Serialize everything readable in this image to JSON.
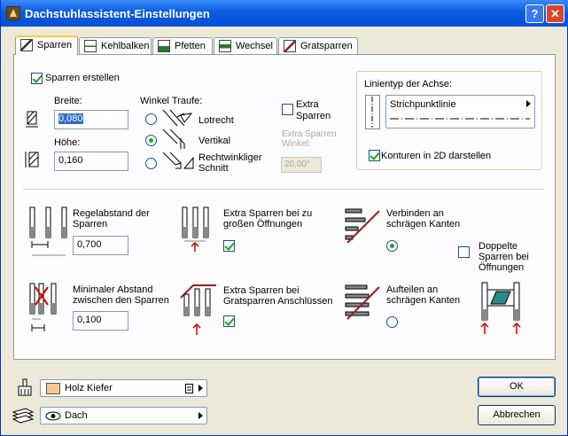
{
  "window": {
    "title": "Dachstuhlassistent-Einstellungen",
    "help_label": "?",
    "close_label": "✕"
  },
  "tabs": [
    {
      "label": "Sparren",
      "active": true
    },
    {
      "label": "Kehlbalken"
    },
    {
      "label": "Pfetten"
    },
    {
      "label": "Wechsel"
    },
    {
      "label": "Gratsparren"
    }
  ],
  "sparren": {
    "create_label": "Sparren erstellen",
    "create_checked": true,
    "breite_label": "Breite:",
    "breite_value": "0,080",
    "hoehe_label": "Höhe:",
    "hoehe_value": "0,160",
    "winkel_label": "Winkel Traufe:",
    "winkel_options": [
      "Lotrecht",
      "Vertikal",
      "Rechtwinkliger Schnitt"
    ],
    "winkel_selected": "Vertikal",
    "extra_label": "Extra Sparren",
    "extra_checked": false,
    "extra_winkel_label": "Extra Sparren Winkel:",
    "extra_winkel_value": "20,00°"
  },
  "linientyp": {
    "title": "Linientyp der Achse:",
    "value": "Strichpunktlinie",
    "konturen_label": "Konturen in 2D darstellen",
    "konturen_checked": true
  },
  "options": {
    "regelabstand_label": "Regelabstand der Sparren",
    "regelabstand_value": "0,700",
    "extra_oeffnungen_label": "Extra Sparren bei zu großen Öffnungen",
    "extra_oeffnungen_checked": true,
    "verbinden_label": "Verbinden an schrägen Kanten",
    "verbinden_selected": true,
    "doppelte_label": "Doppelte Sparren bei Öffnungen",
    "doppelte_checked": false,
    "min_abstand_label": "Minimaler Abstand zwischen den Sparren",
    "min_abstand_value": "0,100",
    "extra_grat_label": "Extra Sparren bei Gratsparren Anschlüssen",
    "extra_grat_checked": true,
    "aufteilen_label": "Aufteilen an schrägen Kanten",
    "aufteilen_selected": false
  },
  "bottom": {
    "material_value": "Holz Kiefer",
    "material_color": "#f3ca8c",
    "layer_value": "Dach",
    "ok_label": "OK",
    "cancel_label": "Abbrechen"
  }
}
